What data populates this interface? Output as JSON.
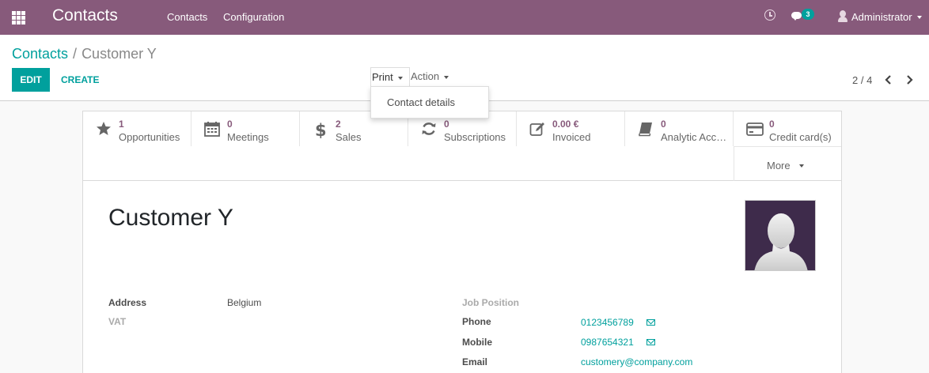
{
  "topbar": {
    "app_title": "Contacts",
    "menu": [
      {
        "label": "Contacts"
      },
      {
        "label": "Configuration"
      }
    ],
    "message_count": "3",
    "user_name": "Administrator"
  },
  "breadcrumb": {
    "parent": "Contacts",
    "separator": "/",
    "current": "Customer Y"
  },
  "toolbar": {
    "edit_label": "EDIT",
    "create_label": "CREATE",
    "print_label": "Print",
    "action_label": "Action",
    "print_menu": [
      "Contact details"
    ]
  },
  "pager": {
    "value": "2 / 4"
  },
  "smart_buttons": [
    {
      "value": "1",
      "label": "Opportunities",
      "icon": "star-icon"
    },
    {
      "value": "0",
      "label": "Meetings",
      "icon": "calendar-icon"
    },
    {
      "value": "2",
      "label": "Sales",
      "icon": "dollar-icon"
    },
    {
      "value": "0",
      "label": "Subscriptions",
      "icon": "refresh-icon"
    },
    {
      "value": "0.00 €",
      "label": "Invoiced",
      "icon": "pencil-square-icon"
    },
    {
      "value": "0",
      "label": "Analytic Acc…",
      "icon": "book-icon"
    },
    {
      "value": "0",
      "label": "Credit card(s)",
      "icon": "credit-card-icon"
    }
  ],
  "more_label": "More",
  "record": {
    "name": "Customer Y",
    "left_fields": [
      {
        "label": "Address",
        "value": "Belgium"
      },
      {
        "label": "VAT",
        "value": ""
      }
    ],
    "right_fields": [
      {
        "label": "Job Position",
        "value": ""
      },
      {
        "label": "Phone",
        "value": "0123456789"
      },
      {
        "label": "Mobile",
        "value": "0987654321"
      },
      {
        "label": "Email",
        "value": "customery@company.com"
      }
    ]
  },
  "colors": {
    "brand": "#875a7b",
    "accent": "#00a09d"
  }
}
